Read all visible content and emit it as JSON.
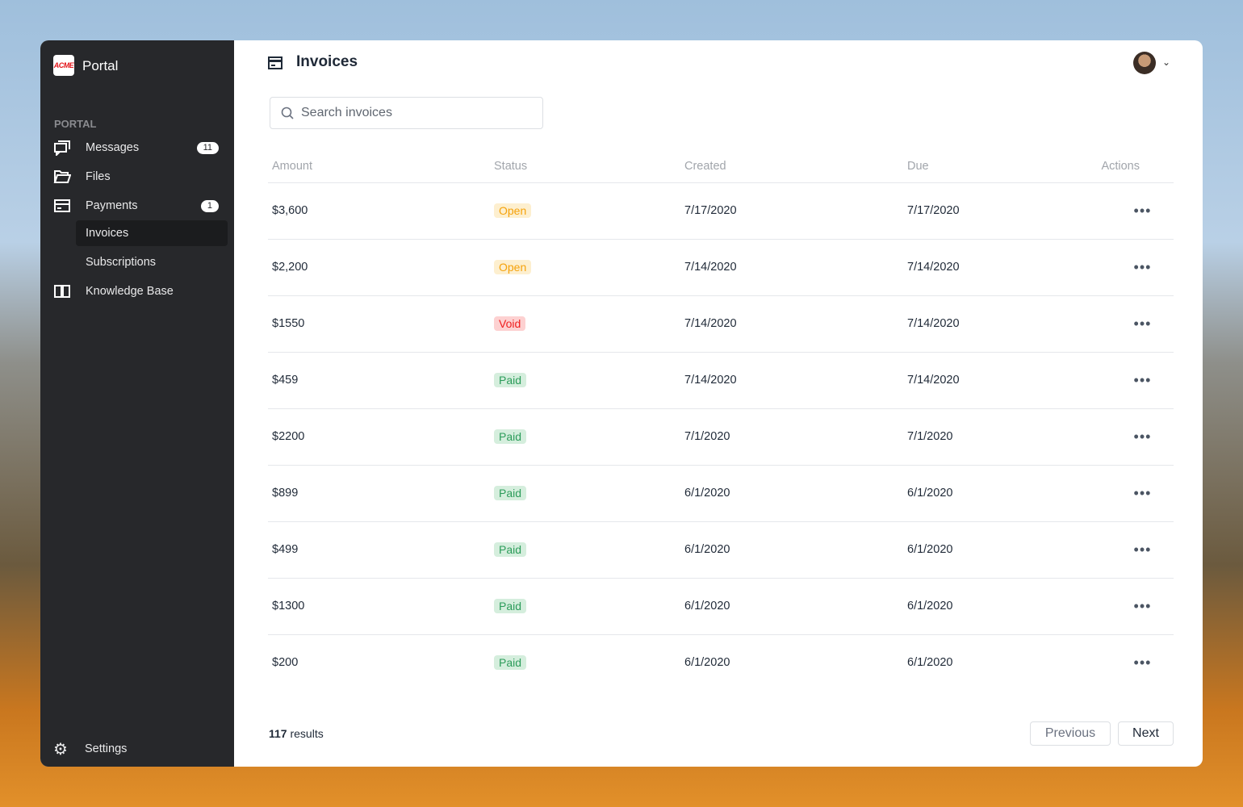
{
  "sidebar": {
    "logo": "ACME",
    "brand": "Portal",
    "section": "PORTAL",
    "items": [
      {
        "label": "Messages",
        "badge": "11"
      },
      {
        "label": "Files"
      },
      {
        "label": "Payments",
        "badge": "1"
      },
      {
        "label": "Invoices"
      },
      {
        "label": "Subscriptions"
      },
      {
        "label": "Knowledge Base"
      }
    ],
    "settings": "Settings"
  },
  "header": {
    "title": "Invoices"
  },
  "search": {
    "placeholder": "Search invoices"
  },
  "table": {
    "columns": [
      "Amount",
      "Status",
      "Created",
      "Due",
      "Actions"
    ],
    "rows": [
      [
        "$3,600",
        "Open",
        "7/17/2020",
        "7/17/2020"
      ],
      [
        "$2,200",
        "Open",
        "7/14/2020",
        "7/14/2020"
      ],
      [
        "$1550",
        "Void",
        "7/14/2020",
        "7/14/2020"
      ],
      [
        "$459",
        "Paid",
        "7/14/2020",
        "7/14/2020"
      ],
      [
        "$2200",
        "Paid",
        "7/1/2020",
        "7/1/2020"
      ],
      [
        "$899",
        "Paid",
        "6/1/2020",
        "6/1/2020"
      ],
      [
        "$499",
        "Paid",
        "6/1/2020",
        "6/1/2020"
      ],
      [
        "$1300",
        "Paid",
        "6/1/2020",
        "6/1/2020"
      ],
      [
        "$200",
        "Paid",
        "6/1/2020",
        "6/1/2020"
      ]
    ],
    "actions_glyph": "•••"
  },
  "footer": {
    "count": "117",
    "results_label": " results",
    "previous": "Previous",
    "next": "Next"
  }
}
